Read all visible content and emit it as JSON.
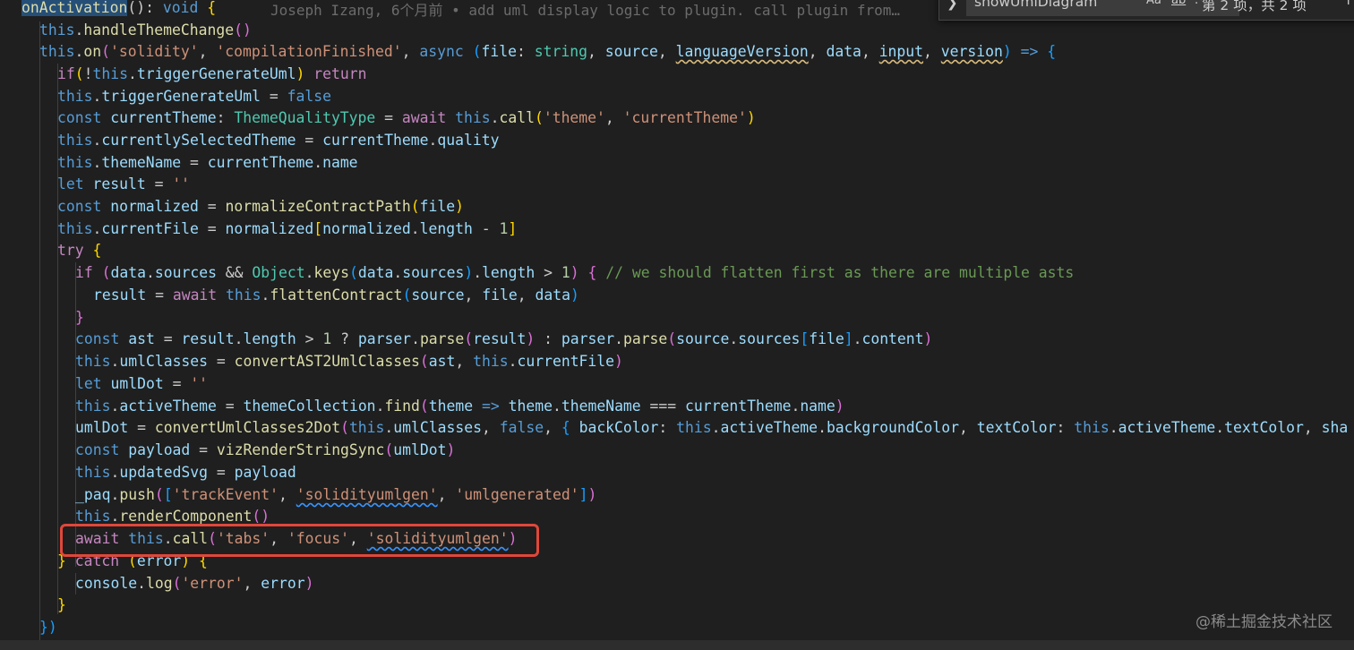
{
  "editor": {
    "blame": "Joseph Izang, 6个月前 • add uml display logic to plugin. call plugin from…"
  },
  "find_widget": {
    "query": "showUmlDiagram",
    "match_case_label": "Aa",
    "whole_word_label": "ab",
    "regex_label": ".*",
    "result_count": "第 2 项，共 2 项",
    "toggle_icon": "chevron-right-icon",
    "prev_icon": "arrow-up-icon"
  },
  "watermark": "@稀土掘金技术社区",
  "colors": {
    "background": "#1f1f1f",
    "highlight_box": "#e0473a",
    "keyword": "#569cd6",
    "control": "#c586c0",
    "variable": "#9cdcfe",
    "function": "#dcdcaa",
    "string": "#ce9178",
    "type": "#4ec9b0"
  },
  "code_lines": [
    [
      [
        "fn",
        "onActivation"
      ],
      [
        "pl",
        "(): "
      ],
      [
        "kw",
        "void"
      ],
      [
        "pl",
        " "
      ],
      [
        "br1",
        "{"
      ]
    ],
    [
      [
        "kw",
        "this"
      ],
      [
        "pl",
        "."
      ],
      [
        "fn",
        "handleThemeChange"
      ],
      [
        "br2",
        "()"
      ]
    ],
    [
      [
        "kw",
        "this"
      ],
      [
        "pl",
        "."
      ],
      [
        "fn",
        "on"
      ],
      [
        "br2",
        "("
      ],
      [
        "str",
        "'solidity'"
      ],
      [
        "pl",
        ", "
      ],
      [
        "str",
        "'compilationFinished'"
      ],
      [
        "pl",
        ", "
      ],
      [
        "kw",
        "async"
      ],
      [
        "pl",
        " "
      ],
      [
        "br3",
        "("
      ],
      [
        "var",
        "file"
      ],
      [
        "pl",
        ": "
      ],
      [
        "ty",
        "string"
      ],
      [
        "pl",
        ", "
      ],
      [
        "var",
        "source"
      ],
      [
        "pl",
        ", "
      ],
      [
        "var",
        "languageVersion"
      ],
      [
        "pl",
        ", "
      ],
      [
        "var",
        "data"
      ],
      [
        "pl",
        ", "
      ],
      [
        "var",
        "input"
      ],
      [
        "pl",
        ", "
      ],
      [
        "var",
        "version"
      ],
      [
        "br3",
        ")"
      ],
      [
        "pl",
        " "
      ],
      [
        "kw",
        "=>"
      ],
      [
        "pl",
        " "
      ],
      [
        "br3",
        "{"
      ]
    ],
    [
      [
        "ctl",
        "if"
      ],
      [
        "br1",
        "("
      ],
      [
        "pl",
        "!"
      ],
      [
        "kw",
        "this"
      ],
      [
        "pl",
        "."
      ],
      [
        "var",
        "triggerGenerateUml"
      ],
      [
        "br1",
        ")"
      ],
      [
        "pl",
        " "
      ],
      [
        "ctl",
        "return"
      ]
    ],
    [
      [
        "kw",
        "this"
      ],
      [
        "pl",
        "."
      ],
      [
        "var",
        "triggerGenerateUml"
      ],
      [
        "pl",
        " = "
      ],
      [
        "kw",
        "false"
      ]
    ],
    [
      [
        "kw",
        "const"
      ],
      [
        "pl",
        " "
      ],
      [
        "var",
        "currentTheme"
      ],
      [
        "pl",
        ": "
      ],
      [
        "ty",
        "ThemeQualityType"
      ],
      [
        "pl",
        " = "
      ],
      [
        "ctl",
        "await"
      ],
      [
        "pl",
        " "
      ],
      [
        "kw",
        "this"
      ],
      [
        "pl",
        "."
      ],
      [
        "fn",
        "call"
      ],
      [
        "br1",
        "("
      ],
      [
        "str",
        "'theme'"
      ],
      [
        "pl",
        ", "
      ],
      [
        "str",
        "'currentTheme'"
      ],
      [
        "br1",
        ")"
      ]
    ],
    [
      [
        "kw",
        "this"
      ],
      [
        "pl",
        "."
      ],
      [
        "var",
        "currentlySelectedTheme"
      ],
      [
        "pl",
        " = "
      ],
      [
        "var",
        "currentTheme"
      ],
      [
        "pl",
        "."
      ],
      [
        "var",
        "quality"
      ]
    ],
    [
      [
        "kw",
        "this"
      ],
      [
        "pl",
        "."
      ],
      [
        "var",
        "themeName"
      ],
      [
        "pl",
        " = "
      ],
      [
        "var",
        "currentTheme"
      ],
      [
        "pl",
        "."
      ],
      [
        "var",
        "name"
      ]
    ],
    [
      [
        "kw",
        "let"
      ],
      [
        "pl",
        " "
      ],
      [
        "var",
        "result"
      ],
      [
        "pl",
        " = "
      ],
      [
        "str",
        "''"
      ]
    ],
    [
      [
        "kw",
        "const"
      ],
      [
        "pl",
        " "
      ],
      [
        "var",
        "normalized"
      ],
      [
        "pl",
        " = "
      ],
      [
        "fn",
        "normalizeContractPath"
      ],
      [
        "br1",
        "("
      ],
      [
        "var",
        "file"
      ],
      [
        "br1",
        ")"
      ]
    ],
    [
      [
        "kw",
        "this"
      ],
      [
        "pl",
        "."
      ],
      [
        "var",
        "currentFile"
      ],
      [
        "pl",
        " = "
      ],
      [
        "var",
        "normalized"
      ],
      [
        "br1",
        "["
      ],
      [
        "var",
        "normalized"
      ],
      [
        "pl",
        "."
      ],
      [
        "var",
        "length"
      ],
      [
        "pl",
        " - "
      ],
      [
        "num",
        "1"
      ],
      [
        "br1",
        "]"
      ]
    ],
    [
      [
        "ctl",
        "try"
      ],
      [
        "pl",
        " "
      ],
      [
        "br1",
        "{"
      ]
    ],
    [
      [
        "ctl",
        "if"
      ],
      [
        "pl",
        " "
      ],
      [
        "br2",
        "("
      ],
      [
        "var",
        "data"
      ],
      [
        "pl",
        "."
      ],
      [
        "var",
        "sources"
      ],
      [
        "pl",
        " && "
      ],
      [
        "ty",
        "Object"
      ],
      [
        "pl",
        "."
      ],
      [
        "fn",
        "keys"
      ],
      [
        "br3",
        "("
      ],
      [
        "var",
        "data"
      ],
      [
        "pl",
        "."
      ],
      [
        "var",
        "sources"
      ],
      [
        "br3",
        ")"
      ],
      [
        "pl",
        "."
      ],
      [
        "var",
        "length"
      ],
      [
        "pl",
        " > "
      ],
      [
        "num",
        "1"
      ],
      [
        "br2",
        ")"
      ],
      [
        "pl",
        " "
      ],
      [
        "br2",
        "{"
      ],
      [
        "pl",
        " "
      ],
      [
        "cm",
        "// we should flatten first as there are multiple asts"
      ]
    ],
    [
      [
        "var",
        "result"
      ],
      [
        "pl",
        " = "
      ],
      [
        "ctl",
        "await"
      ],
      [
        "pl",
        " "
      ],
      [
        "kw",
        "this"
      ],
      [
        "pl",
        "."
      ],
      [
        "fn",
        "flattenContract"
      ],
      [
        "br3",
        "("
      ],
      [
        "var",
        "source"
      ],
      [
        "pl",
        ", "
      ],
      [
        "var",
        "file"
      ],
      [
        "pl",
        ", "
      ],
      [
        "var",
        "data"
      ],
      [
        "br3",
        ")"
      ]
    ],
    [
      [
        "br2",
        "}"
      ]
    ],
    [
      [
        "kw",
        "const"
      ],
      [
        "pl",
        " "
      ],
      [
        "var",
        "ast"
      ],
      [
        "pl",
        " = "
      ],
      [
        "var",
        "result"
      ],
      [
        "pl",
        "."
      ],
      [
        "var",
        "length"
      ],
      [
        "pl",
        " > "
      ],
      [
        "num",
        "1"
      ],
      [
        "pl",
        " ? "
      ],
      [
        "var",
        "parser"
      ],
      [
        "pl",
        "."
      ],
      [
        "fn",
        "parse"
      ],
      [
        "br2",
        "("
      ],
      [
        "var",
        "result"
      ],
      [
        "br2",
        ")"
      ],
      [
        "pl",
        " : "
      ],
      [
        "var",
        "parser"
      ],
      [
        "pl",
        "."
      ],
      [
        "fn",
        "parse"
      ],
      [
        "br2",
        "("
      ],
      [
        "var",
        "source"
      ],
      [
        "pl",
        "."
      ],
      [
        "var",
        "sources"
      ],
      [
        "br3",
        "["
      ],
      [
        "var",
        "file"
      ],
      [
        "br3",
        "]"
      ],
      [
        "pl",
        "."
      ],
      [
        "var",
        "content"
      ],
      [
        "br2",
        ")"
      ]
    ],
    [
      [
        "kw",
        "this"
      ],
      [
        "pl",
        "."
      ],
      [
        "var",
        "umlClasses"
      ],
      [
        "pl",
        " = "
      ],
      [
        "fn",
        "convertAST2UmlClasses"
      ],
      [
        "br2",
        "("
      ],
      [
        "var",
        "ast"
      ],
      [
        "pl",
        ", "
      ],
      [
        "kw",
        "this"
      ],
      [
        "pl",
        "."
      ],
      [
        "var",
        "currentFile"
      ],
      [
        "br2",
        ")"
      ]
    ],
    [
      [
        "kw",
        "let"
      ],
      [
        "pl",
        " "
      ],
      [
        "var",
        "umlDot"
      ],
      [
        "pl",
        " = "
      ],
      [
        "str",
        "''"
      ]
    ],
    [
      [
        "kw",
        "this"
      ],
      [
        "pl",
        "."
      ],
      [
        "var",
        "activeTheme"
      ],
      [
        "pl",
        " = "
      ],
      [
        "var",
        "themeCollection"
      ],
      [
        "pl",
        "."
      ],
      [
        "fn",
        "find"
      ],
      [
        "br2",
        "("
      ],
      [
        "var",
        "theme"
      ],
      [
        "pl",
        " "
      ],
      [
        "kw",
        "=>"
      ],
      [
        "pl",
        " "
      ],
      [
        "var",
        "theme"
      ],
      [
        "pl",
        "."
      ],
      [
        "var",
        "themeName"
      ],
      [
        "pl",
        " === "
      ],
      [
        "var",
        "currentTheme"
      ],
      [
        "pl",
        "."
      ],
      [
        "var",
        "name"
      ],
      [
        "br2",
        ")"
      ]
    ],
    [
      [
        "var",
        "umlDot"
      ],
      [
        "pl",
        " = "
      ],
      [
        "fn",
        "convertUmlClasses2Dot"
      ],
      [
        "br2",
        "("
      ],
      [
        "kw",
        "this"
      ],
      [
        "pl",
        "."
      ],
      [
        "var",
        "umlClasses"
      ],
      [
        "pl",
        ", "
      ],
      [
        "kw",
        "false"
      ],
      [
        "pl",
        ", "
      ],
      [
        "br3",
        "{"
      ],
      [
        "pl",
        " "
      ],
      [
        "var",
        "backColor"
      ],
      [
        "pl",
        ": "
      ],
      [
        "kw",
        "this"
      ],
      [
        "pl",
        "."
      ],
      [
        "var",
        "activeTheme"
      ],
      [
        "pl",
        "."
      ],
      [
        "var",
        "backgroundColor"
      ],
      [
        "pl",
        ", "
      ],
      [
        "var",
        "textColor"
      ],
      [
        "pl",
        ": "
      ],
      [
        "kw",
        "this"
      ],
      [
        "pl",
        "."
      ],
      [
        "var",
        "activeTheme"
      ],
      [
        "pl",
        "."
      ],
      [
        "var",
        "textColor"
      ],
      [
        "pl",
        ", "
      ],
      [
        "var",
        "sha"
      ]
    ],
    [
      [
        "kw",
        "const"
      ],
      [
        "pl",
        " "
      ],
      [
        "var",
        "payload"
      ],
      [
        "pl",
        " = "
      ],
      [
        "fn",
        "vizRenderStringSync"
      ],
      [
        "br2",
        "("
      ],
      [
        "var",
        "umlDot"
      ],
      [
        "br2",
        ")"
      ]
    ],
    [
      [
        "kw",
        "this"
      ],
      [
        "pl",
        "."
      ],
      [
        "var",
        "updatedSvg"
      ],
      [
        "pl",
        " = "
      ],
      [
        "var",
        "payload"
      ]
    ],
    [
      [
        "var",
        "_paq"
      ],
      [
        "pl",
        "."
      ],
      [
        "fn",
        "push"
      ],
      [
        "br2",
        "("
      ],
      [
        "br3",
        "["
      ],
      [
        "str",
        "'trackEvent'"
      ],
      [
        "pl",
        ", "
      ],
      [
        "str",
        "'solidityumlgen'"
      ],
      [
        "pl",
        ", "
      ],
      [
        "str",
        "'umlgenerated'"
      ],
      [
        "br3",
        "]"
      ],
      [
        "br2",
        ")"
      ]
    ],
    [
      [
        "kw",
        "this"
      ],
      [
        "pl",
        "."
      ],
      [
        "fn",
        "renderComponent"
      ],
      [
        "br2",
        "()"
      ]
    ],
    [
      [
        "ctl",
        "await"
      ],
      [
        "pl",
        " "
      ],
      [
        "kw",
        "this"
      ],
      [
        "pl",
        "."
      ],
      [
        "fn",
        "call"
      ],
      [
        "br2",
        "("
      ],
      [
        "str",
        "'tabs'"
      ],
      [
        "pl",
        ", "
      ],
      [
        "str",
        "'focus'"
      ],
      [
        "pl",
        ", "
      ],
      [
        "str",
        "'solidityumlgen'"
      ],
      [
        "br2",
        ")"
      ]
    ],
    [
      [
        "br1",
        "}"
      ],
      [
        "pl",
        " "
      ],
      [
        "ctl",
        "catch"
      ],
      [
        "pl",
        " "
      ],
      [
        "br1",
        "("
      ],
      [
        "var",
        "error"
      ],
      [
        "br1",
        ")"
      ],
      [
        "pl",
        " "
      ],
      [
        "br1",
        "{"
      ]
    ],
    [
      [
        "var",
        "console"
      ],
      [
        "pl",
        "."
      ],
      [
        "fn",
        "log"
      ],
      [
        "br2",
        "("
      ],
      [
        "str",
        "'error'"
      ],
      [
        "pl",
        ", "
      ],
      [
        "var",
        "error"
      ],
      [
        "br2",
        ")"
      ]
    ],
    [
      [
        "br1",
        "}"
      ]
    ],
    [
      [
        "br3",
        "})"
      ]
    ],
    [
      [
        "br1",
        "}"
      ]
    ]
  ]
}
